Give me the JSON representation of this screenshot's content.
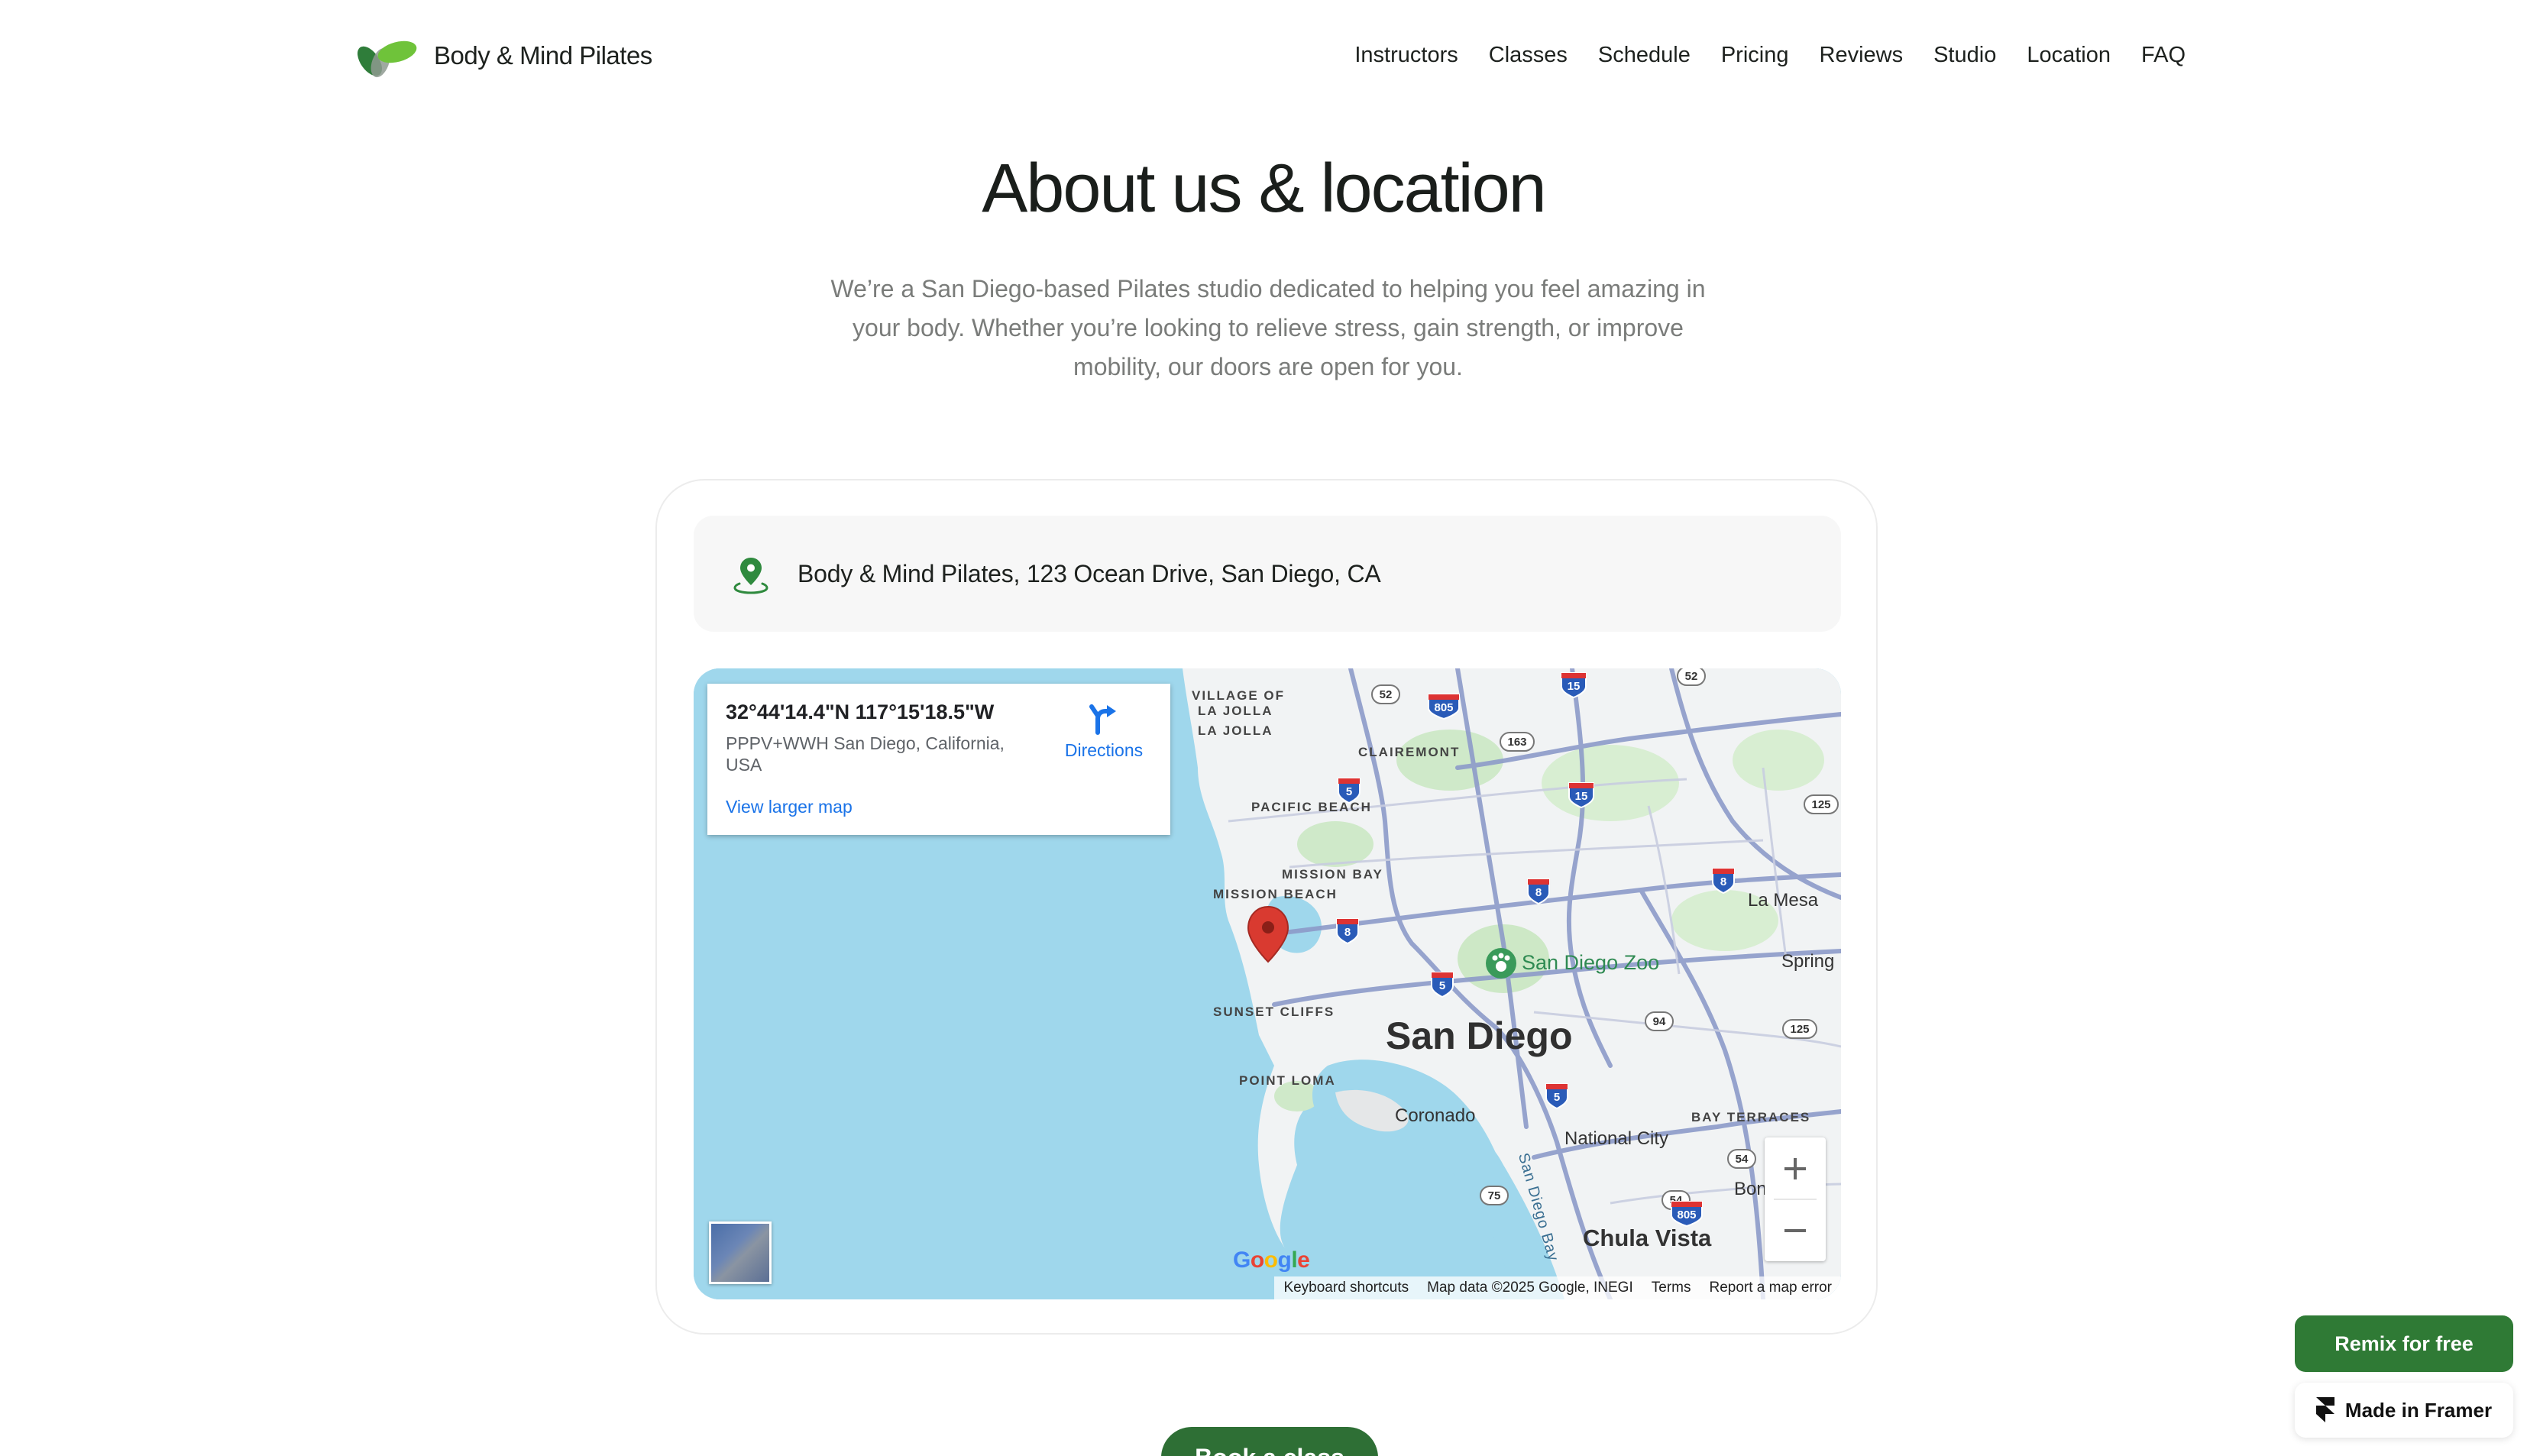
{
  "brand": {
    "name": "Body & Mind Pilates",
    "logo_icon": "leaf-logo-icon",
    "leaf_colors": [
      "#2f7d3a",
      "#6fc33a",
      "#8e9a90"
    ]
  },
  "nav": [
    "Instructors",
    "Classes",
    "Schedule",
    "Pricing",
    "Reviews",
    "Studio",
    "Location",
    "FAQ"
  ],
  "hero": {
    "title": "About us & location",
    "description": "We’re a San Diego-based Pilates studio dedicated to helping you feel amazing in your body. Whether you’re looking to relieve stress, gain strength, or improve mobility, our doors are open for you."
  },
  "location": {
    "address": "Body & Mind Pilates, 123 Ocean Drive, San Diego, CA",
    "pin_icon": "map-pin-icon"
  },
  "map": {
    "info": {
      "coords": "32°44'14.4\"N 117°15'18.5\"W",
      "address": "PPPV+WWH San Diego, California, USA",
      "directions": "Directions",
      "larger_map": "View larger map"
    },
    "labels": {
      "village_of": "VILLAGE OF",
      "la_jolla_1": "LA JOLLA",
      "la_jolla_2": "LA JOLLA",
      "clairemont": "CLAIREMONT",
      "pacific_beach": "PACIFIC BEACH",
      "mission_bay": "MISSION BAY",
      "mission_beach": "MISSION BEACH",
      "la_mesa": "La Mesa",
      "spring": "Spring",
      "zoo": "San Diego Zoo",
      "sunset_cliffs": "SUNSET CLIFFS",
      "city": "San Diego",
      "point_loma": "POINT LOMA",
      "coronado": "Coronado",
      "bay_terraces": "BAY TERRACES",
      "national_city": "National City",
      "bay": "San Diego Bay",
      "boni": "Boni",
      "chula_vista": "Chula Vista"
    },
    "shields": {
      "r52a": "52",
      "r805a": "805",
      "r15a": "15",
      "r52b": "52",
      "r163": "163",
      "r5a": "5",
      "r15b": "15",
      "r125a": "125",
      "r8a": "8",
      "r8b": "8",
      "r8c": "8",
      "r5b": "5",
      "r94": "94",
      "r125b": "125",
      "r5c": "5",
      "r54a": "54",
      "r54b": "54",
      "r805b": "805",
      "r75": "75"
    },
    "google_logo": "Google",
    "attribution": [
      "Keyboard shortcuts",
      "Map data ©2025 Google, INEGI",
      "Terms",
      "Report a map error"
    ],
    "marker_color": "#d93a30",
    "water_color": "#9fd7ec"
  },
  "cta": {
    "label": "Book a class"
  },
  "badges": {
    "remix": "Remix for free",
    "framer": "Made in Framer"
  },
  "colors": {
    "accent": "#2e6f35",
    "text": "#1d211e",
    "muted": "#7a7c7a"
  }
}
